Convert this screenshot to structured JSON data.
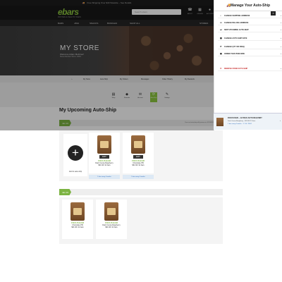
{
  "topbar": {
    "text": "Free Shipping Over $49 Sitewide – See Details"
  },
  "header": {
    "logo": "ebars",
    "logo_sub": "PROTEIN & HEALTHY BARS",
    "search_placeholder": "Search ebars",
    "icons": [
      {
        "name": "phone-icon",
        "label": "ABOUT"
      },
      {
        "name": "calendar-icon",
        "label": "ORDERS"
      },
      {
        "name": "user-icon",
        "label": "ACCOUNT"
      },
      {
        "name": "cart-icon",
        "label": "CART"
      }
    ]
  },
  "nav": [
    "BARS",
    "JAVA",
    "SNACKS",
    "BUNDLES",
    "SHOP ALL",
    "STORES"
  ],
  "hero": {
    "title": "MY STORE",
    "welcome": "Welcome Adam Meltzner!",
    "member": "Store Member Since: 2019"
  },
  "subnav": [
    "My Store",
    "Auto-Ship",
    "My Orders",
    "Messages",
    "Order History",
    "My Rewards"
  ],
  "tools": [
    "Shop",
    "Rewards",
    "Account",
    "Auto-Ship",
    "Settings"
  ],
  "page": {
    "title": "My Upcoming Auto-Ship",
    "section1": "Jan 10",
    "section1_note": "Your next auto-ship will process on: 01/10/2024",
    "section2": "Jan 10"
  },
  "add_card": "Add to auto-ship",
  "products": [
    {
      "edit": "EDIT",
      "name": "FOCUS BAR",
      "desc": "Dark Cocoa Raspberry",
      "price": "$31.68 /12 bars",
      "ship": "1 bar every 4 weeks"
    },
    {
      "edit": "EDIT",
      "name": "FOCUS BAR",
      "desc": "Chocolate PB",
      "price": "$31.68 /12 bars",
      "ship": "1 bar every 4 weeks"
    },
    {
      "name": "FOCUS BAR",
      "desc": "Chocolate PB",
      "price": "$31.68 /12 bars"
    },
    {
      "name": "FOCUS BAR",
      "desc": "Dark Cocoa Raspberry",
      "price": "$31.68 /12 bars"
    }
  ],
  "panel": {
    "title": "Manage Your Auto-Ship",
    "close": "×",
    "items": [
      "CHANGE SHIPPING ADDRESS",
      "CHANGE BILLING ADDRESS",
      "SKIP UPCOMING AUTO-SHIP",
      "CHANGE AUTO-SHIP DATE",
      "CHANGE QTY OR FREQ",
      "ORDER THIS ITEM NOW"
    ],
    "remove": "REMOVE FROM AUTO-SHIP",
    "preview": {
      "title": "FOCUS BAR – 12 PACK AUTO DELIVERY",
      "line1": "Dark Cocoa Raspberry · $31.68 /12 bars",
      "line2": "1 bar every 4 weeks · 1 / 10 / 2024"
    }
  }
}
